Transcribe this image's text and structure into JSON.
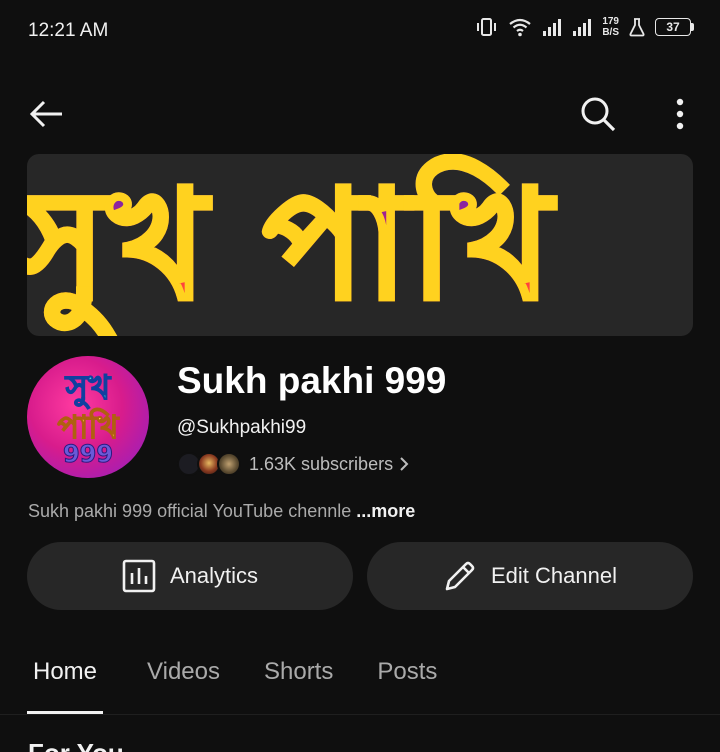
{
  "status_bar": {
    "time": "12:21 AM",
    "net_speed_value": "179",
    "net_speed_unit": "B/S",
    "battery": "37"
  },
  "app_bar": {
    "back_icon": "arrow-left-icon",
    "search_icon": "search-icon",
    "more_icon": "more-vertical-icon"
  },
  "banner": {
    "text": "সুখ পাখি"
  },
  "channel": {
    "avatar_line1": "সুখ",
    "avatar_line2": "পাখি",
    "avatar_line3": "999",
    "name": "Sukh pakhi 999",
    "handle": "@Sukhpakhi99",
    "subscribers": "1.63K subscribers",
    "description": "Sukh pakhi 999 official YouTube chennle ",
    "description_more": "...more"
  },
  "actions": {
    "analytics_label": "Analytics",
    "analytics_icon": "analytics-icon",
    "edit_label": "Edit Channel",
    "edit_icon": "pencil-icon"
  },
  "tabs": [
    {
      "label": "Home",
      "active": true
    },
    {
      "label": "Videos",
      "active": false
    },
    {
      "label": "Shorts",
      "active": false
    },
    {
      "label": "Posts",
      "active": false
    }
  ],
  "section": {
    "title": "For You"
  },
  "colors": {
    "background": "#0f0f0f",
    "button_bg": "#272727",
    "text_primary": "#f1f1f1",
    "text_secondary": "#aaaaaa"
  }
}
